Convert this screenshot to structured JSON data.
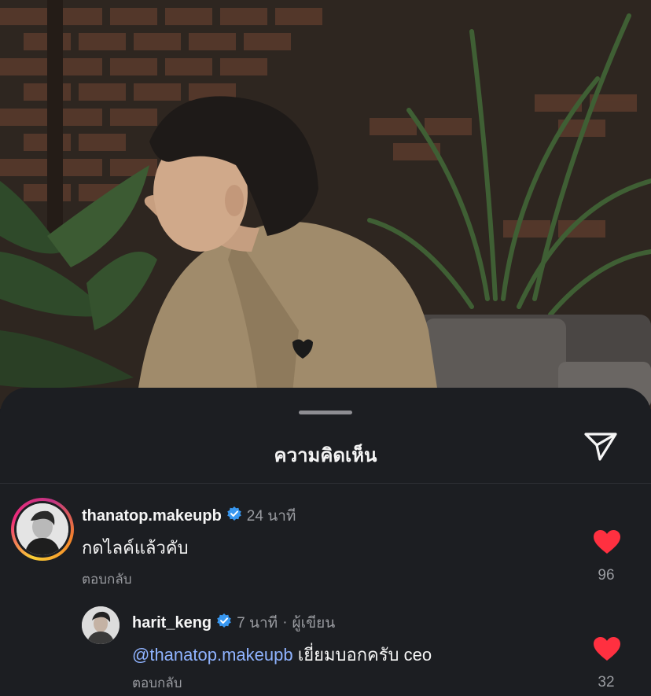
{
  "photo": {
    "description_icon": "post-photo"
  },
  "sheet": {
    "title": "ความคิดเห็น",
    "share_icon": "send-icon"
  },
  "comments": [
    {
      "username": "thanatop.makeupb",
      "verified": true,
      "time": "24 นาที",
      "text": "กดไลค์แล้วคับ",
      "reply_label": "ตอบกลับ",
      "liked": true,
      "like_count": "96"
    },
    {
      "username": "harit_keng",
      "verified": true,
      "time": "7 นาที",
      "separator": "·",
      "author_label": "ผู้เขียน",
      "mention": "@thanatop.makeupb",
      "text": "เยี่ยมบอกครับ ceo",
      "reply_label": "ตอบกลับ",
      "liked": true,
      "like_count": "32"
    }
  ],
  "colors": {
    "heart": "#ff3040",
    "verified": "#3897f0",
    "mention": "#8fb3ff"
  }
}
